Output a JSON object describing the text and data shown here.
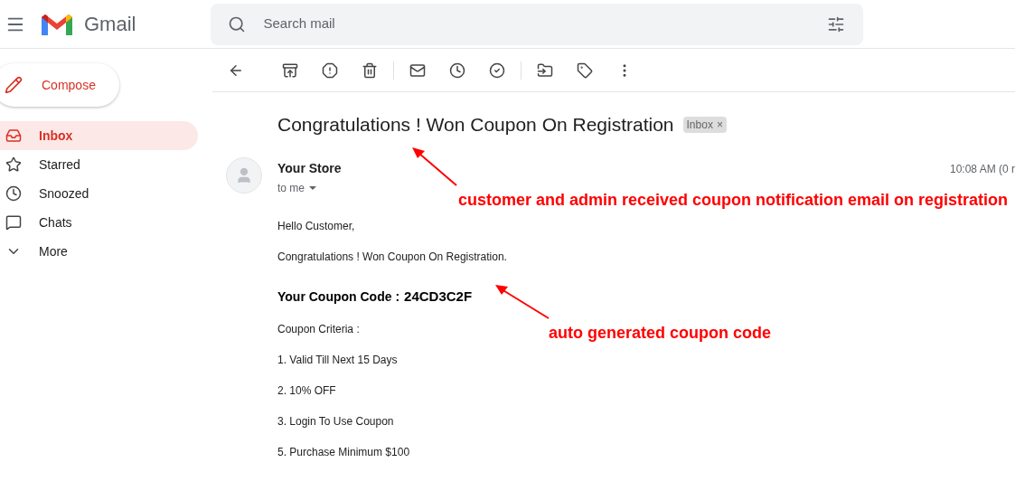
{
  "header": {
    "app_name": "Gmail",
    "search": {
      "placeholder": "Search mail"
    }
  },
  "compose": {
    "label": "Compose"
  },
  "sidebar": {
    "items": [
      {
        "kind": "inbox",
        "label": "Inbox",
        "selected": true
      },
      {
        "kind": "starred",
        "label": "Starred",
        "selected": false
      },
      {
        "kind": "snoozed",
        "label": "Snoozed",
        "selected": false
      },
      {
        "kind": "chats",
        "label": "Chats",
        "selected": false
      },
      {
        "kind": "more",
        "label": "More",
        "selected": false
      }
    ]
  },
  "email": {
    "subject": "Congratulations ! Won Coupon On Registration",
    "label_chip": "Inbox",
    "label_chip_close": "×",
    "sender": "Your Store",
    "recipient": "to me",
    "time": "10:08 AM (0 r",
    "greeting": "Hello Customer,",
    "intro": "Congratulations ! Won Coupon On Registration.",
    "code_label": "Your Coupon Code :",
    "code": "24CD3C2F",
    "criteria_title": "Coupon Criteria :",
    "criteria": [
      "1. Valid Till Next 15 Days",
      "2. 10% OFF",
      "3. Login To Use Coupon",
      "5. Purchase Minimum $100"
    ]
  },
  "annotations": [
    {
      "kind": "subject",
      "text": "customer and admin received coupon notification email on registration"
    },
    {
      "kind": "code",
      "text": "auto generated coupon code"
    }
  ]
}
